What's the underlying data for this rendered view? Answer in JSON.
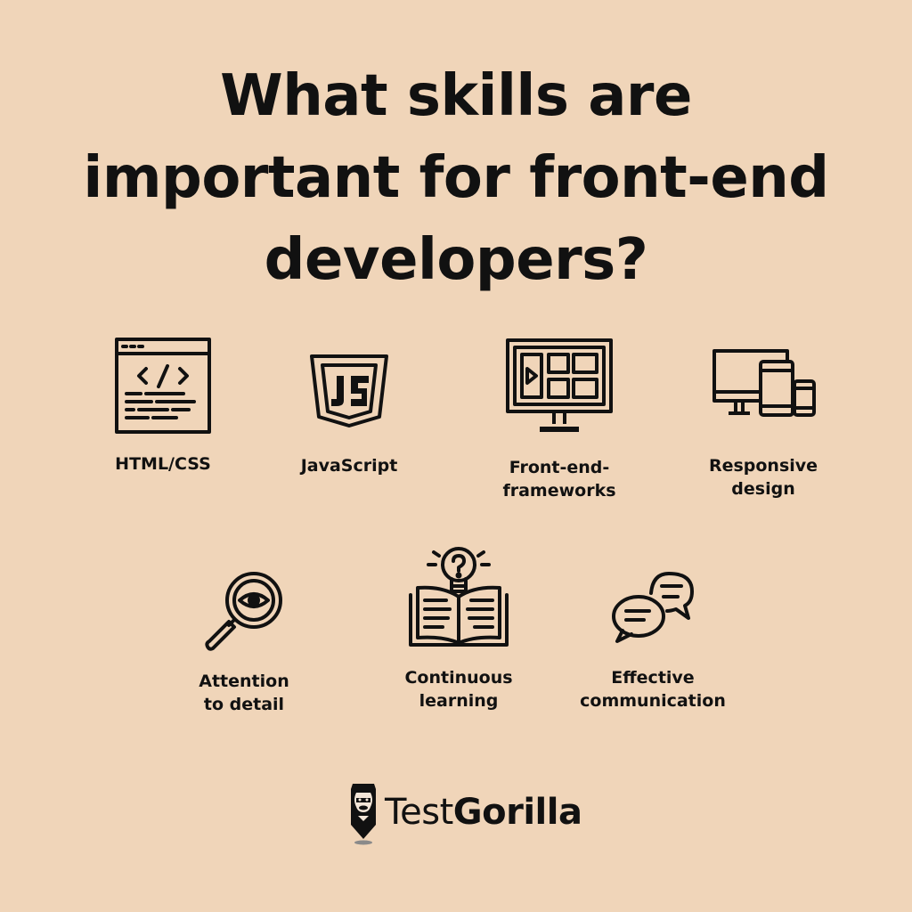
{
  "headline": {
    "line1": "What skills are",
    "line2": "important for front-end",
    "line3": "developers?"
  },
  "skills": [
    {
      "label": "HTML/CSS",
      "icon": "code-window-icon"
    },
    {
      "label": "JavaScript",
      "icon": "javascript-shield-icon"
    },
    {
      "label": "Front-end-\nframeworks",
      "icon": "monitor-layout-icon"
    },
    {
      "label": "Responsive\ndesign",
      "icon": "devices-icon"
    },
    {
      "label": "Attention\nto detail",
      "icon": "magnifier-eye-icon"
    },
    {
      "label": "Continuous\nlearning",
      "icon": "book-lightbulb-icon"
    },
    {
      "label": "Effective\ncommunication",
      "icon": "chat-bubbles-icon"
    }
  ],
  "brand": {
    "name_light": "Test",
    "name_bold": "Gorilla",
    "logo": "gorilla-pencil-logo"
  },
  "colors": {
    "background": "#f0d5b9",
    "ink": "#111111"
  }
}
